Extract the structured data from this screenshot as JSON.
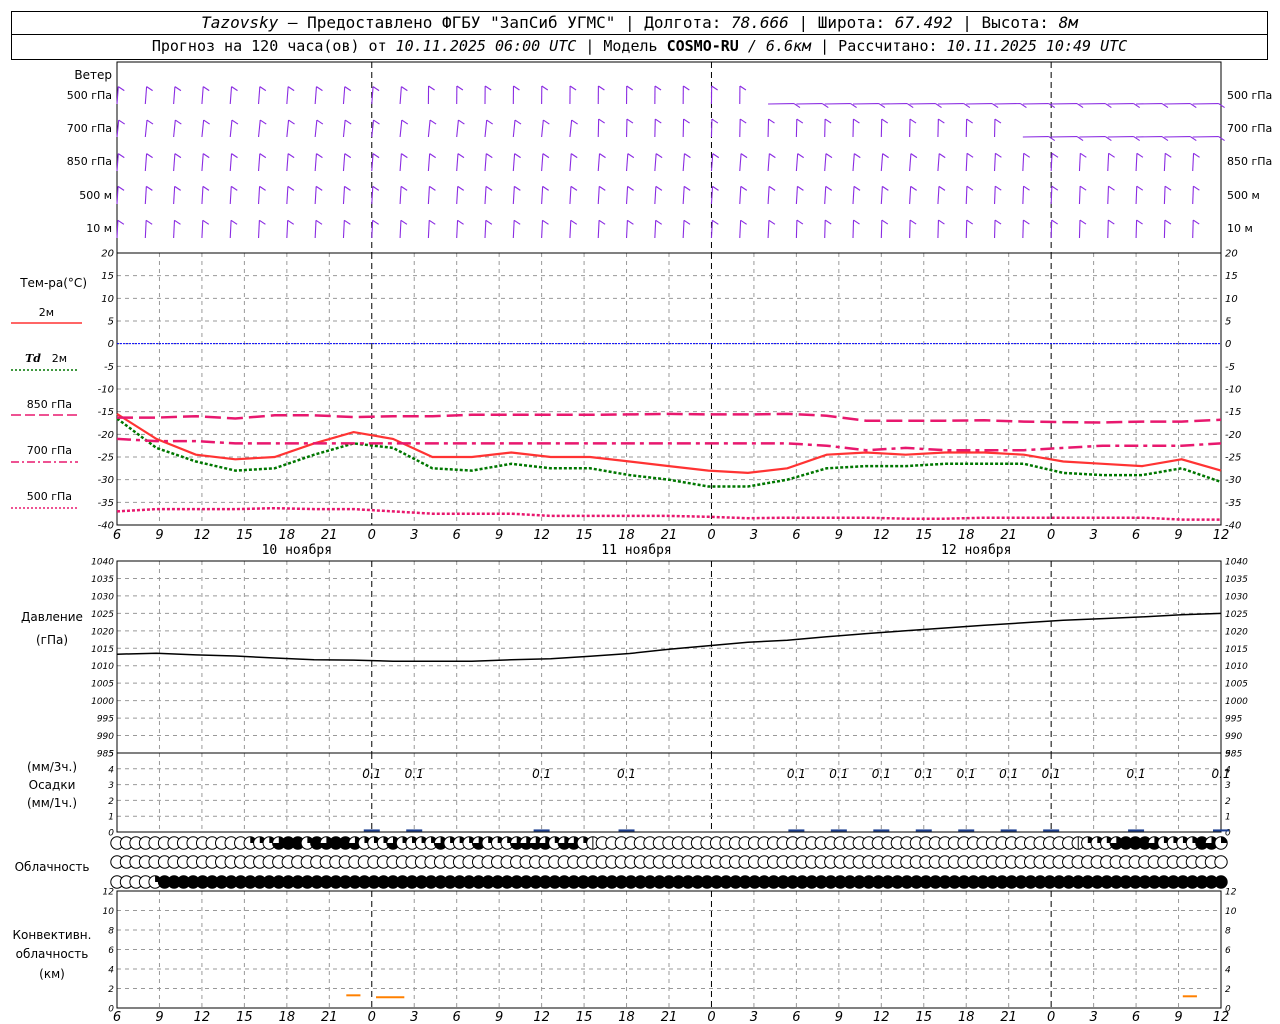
{
  "header": {
    "station": "Tazovsky",
    "provided": "— Предоставлено ФГБУ \"ЗапСиб УГМС\" |",
    "lon_label": "Долгота:",
    "lon_value": "78.666",
    "lat_label": "| Широта:",
    "lat_value": "67.492",
    "alt_label": "| Высота:",
    "alt_value": "8м",
    "forecast_label": "Прогноз на 120 часа(ов) от",
    "forecast_date": "10.11.2025 06:00 UTC",
    "model_label": " | Модель",
    "model_name": "COSMO-RU",
    "model_res": "/ 6.6км",
    "calc_label": "| Рассчитано:",
    "calc_date": "10.11.2025 10:49 UTC"
  },
  "labels": {
    "wind": "Ветер",
    "levels": [
      "500 гПа",
      "700 гПа",
      "850 гПа",
      "500 м",
      "10 м"
    ],
    "temp_title": "Тем-ра(°C)",
    "temp_2m": "2м",
    "td_prefix": "Td",
    "td_2m": "2м",
    "t850": "850 гПа",
    "t700": "700 гПа",
    "t500": "500 гПа",
    "pressure_1": "Давление",
    "pressure_2": "(гПа)",
    "precip_1": "(мм/3ч.)",
    "precip_2": "Осадки",
    "precip_3": "(мм/1ч.)",
    "cloud": "Облачность",
    "conv_1": "Конвективн.",
    "conv_2": "облачность",
    "conv_3": "(км)"
  },
  "colors": {
    "wind": "#8a2be2",
    "t2m": "#ff3333",
    "td2m": "#007700",
    "t850": "#e8186e",
    "t700": "#e8186e",
    "t500": "#e8186e",
    "zero": "#0000ff",
    "pressure": "#000000",
    "precip": "#1a3d8f",
    "conv": "#ff8000",
    "grid": "#999999"
  },
  "chart_data": {
    "type": "line",
    "x_hours": [
      6,
      9,
      12,
      15,
      18,
      21,
      0,
      3,
      6,
      9,
      12,
      15,
      18,
      21,
      0,
      3,
      6,
      9,
      12,
      15,
      18,
      21,
      0,
      3,
      6,
      9,
      12
    ],
    "date_labels": [
      {
        "text": "10 ноября"
      },
      {
        "text": "11 ноября"
      },
      {
        "text": "12 ноября"
      }
    ],
    "temperature": {
      "ylim": [
        -40,
        20
      ],
      "yticks": [
        20,
        15,
        10,
        5,
        0,
        -5,
        -10,
        -15,
        -20,
        -25,
        -30,
        -35,
        -40
      ],
      "series": [
        {
          "name": "2м",
          "values": [
            -15.5,
            -21,
            -24.5,
            -25.5,
            -25,
            -22,
            -19.5,
            -21,
            -25,
            -25,
            -24,
            -25,
            -25,
            -26,
            -27,
            -28,
            -28.5,
            -27.5,
            -24.5,
            -24,
            -24.5,
            -24,
            -24,
            -24.5,
            -26,
            -26.5,
            -27,
            -25.5,
            -28
          ]
        },
        {
          "name": "Td 2м",
          "values": [
            -16.5,
            -23,
            -26,
            -28,
            -27.5,
            -24.5,
            -22,
            -23,
            -27.5,
            -28,
            -26.5,
            -27.5,
            -27.5,
            -29,
            -30,
            -31.5,
            -31.5,
            -30,
            -27.5,
            -27,
            -27,
            -26.5,
            -26.5,
            -26.5,
            -28.5,
            -29,
            -29,
            -27.5,
            -30.5
          ]
        },
        {
          "name": "850 гПа",
          "values": [
            -16.3,
            -16.3,
            -16,
            -16.5,
            -15.8,
            -15.8,
            -16.2,
            -16,
            -16,
            -15.7,
            -15.7,
            -15.7,
            -15.7,
            -15.6,
            -15.5,
            -15.6,
            -15.6,
            -15.5,
            -15.9,
            -17,
            -17,
            -17,
            -16.9,
            -17.2,
            -17.3,
            -17.4,
            -17.2,
            -17.2,
            -16.8
          ]
        },
        {
          "name": "700 гПа",
          "values": [
            -21,
            -21.5,
            -21.5,
            -22,
            -22,
            -22,
            -22,
            -22,
            -22,
            -22,
            -22,
            -22,
            -22,
            -22,
            -22,
            -22,
            -22,
            -22,
            -22.5,
            -23.5,
            -23,
            -23.5,
            -23.5,
            -23.5,
            -23,
            -22.5,
            -22.5,
            -22.5,
            -22
          ]
        },
        {
          "name": "500 гПа",
          "values": [
            -37,
            -36.5,
            -36.5,
            -36.5,
            -36.3,
            -36.5,
            -36.5,
            -37,
            -37.5,
            -37.5,
            -37.5,
            -38,
            -38,
            -38,
            -38,
            -38.2,
            -38.5,
            -38.4,
            -38.4,
            -38.4,
            -38.6,
            -38.6,
            -38.4,
            -38.4,
            -38.4,
            -38.4,
            -38.4,
            -38.8,
            -38.8
          ]
        }
      ]
    },
    "pressure": {
      "ylim": [
        985,
        1040
      ],
      "yticks": [
        1040,
        1035,
        1030,
        1025,
        1020,
        1015,
        1010,
        1005,
        1000,
        995,
        990,
        985
      ],
      "values": [
        1013.3,
        1013.6,
        1013.1,
        1012.8,
        1012.2,
        1011.7,
        1011.6,
        1011.3,
        1011.3,
        1011.3,
        1011.7,
        1012,
        1012.7,
        1013.5,
        1014.7,
        1015.7,
        1016.7,
        1017.3,
        1018.3,
        1019.2,
        1020,
        1020.8,
        1021.6,
        1022.3,
        1023,
        1023.5,
        1024,
        1024.6,
        1025
      ]
    },
    "precip": {
      "ylim": [
        0,
        5
      ],
      "yticks": [
        5,
        4,
        3,
        2,
        1,
        0
      ],
      "labels": [
        {
          "hour": 18,
          "value": "0.1"
        },
        {
          "hour": 21,
          "value": "0.1"
        },
        {
          "hour": 30,
          "value": "0.1"
        },
        {
          "hour": 36,
          "value": "0.1"
        },
        {
          "hour": 48,
          "value": "0.1"
        },
        {
          "hour": 51,
          "value": "0.1"
        },
        {
          "hour": 54,
          "value": "0.1"
        },
        {
          "hour": 57,
          "value": "0.1"
        },
        {
          "hour": 60,
          "value": "0.1"
        },
        {
          "hour": 63,
          "value": "0.1"
        },
        {
          "hour": 66,
          "value": "0.1"
        },
        {
          "hour": 72,
          "value": "0.1"
        },
        {
          "hour": 78,
          "value": "0.1"
        }
      ]
    },
    "cloud_rows": {
      "high": "000000000000002223442434432223222232223222333323321000000000000000000000000000000000000000000000000001222344432222432",
      "mid": "000000000000000000000000000000000000000000000000000000000000000000000000000000000000000000000000000000000000000000000",
      "low": "000024444444444444444444444444444444444444444444444444444444444444444444444444444444444444444444444444444444444444444"
    },
    "convective": {
      "ylim": [
        0,
        12
      ],
      "yticks": [
        12,
        10,
        8,
        6,
        4,
        2,
        0
      ],
      "segments": [
        {
          "from_hour": 16.2,
          "to_hour": 17.2,
          "value": 1.3
        },
        {
          "from_hour": 18.3,
          "to_hour": 20.3,
          "value": 1.1
        },
        {
          "from_hour": 75.3,
          "to_hour": 76.3,
          "value": 1.2
        }
      ]
    }
  }
}
